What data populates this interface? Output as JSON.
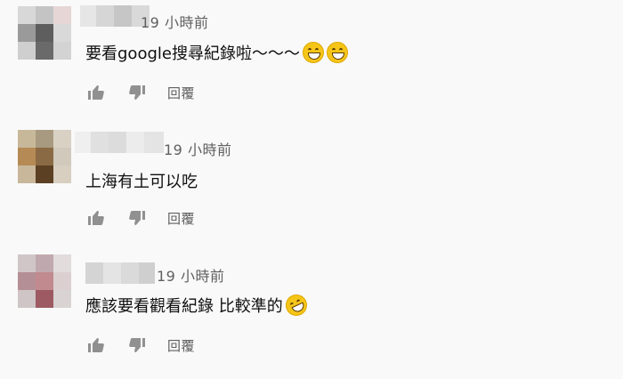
{
  "comments": [
    {
      "time": "19 小時前",
      "text": "要看google搜尋紀錄啦～～～",
      "emoji": [
        "grinning-sweat-emoji",
        "grinning-sweat-emoji"
      ],
      "reply_label": "回覆"
    },
    {
      "time": "19 小時前",
      "text": "上海有土可以吃",
      "emoji": [],
      "reply_label": "回覆"
    },
    {
      "time": "19 小時前",
      "text": "應該要看觀看紀錄 比較準的",
      "emoji": [
        "rolling-laugh-emoji"
      ],
      "reply_label": "回覆"
    }
  ],
  "icons": {
    "like": "thumb-up-icon",
    "dislike": "thumb-down-icon"
  },
  "colors": {
    "background": "#f9f9f9",
    "text": "#0f0f0f",
    "secondary": "#606060"
  }
}
